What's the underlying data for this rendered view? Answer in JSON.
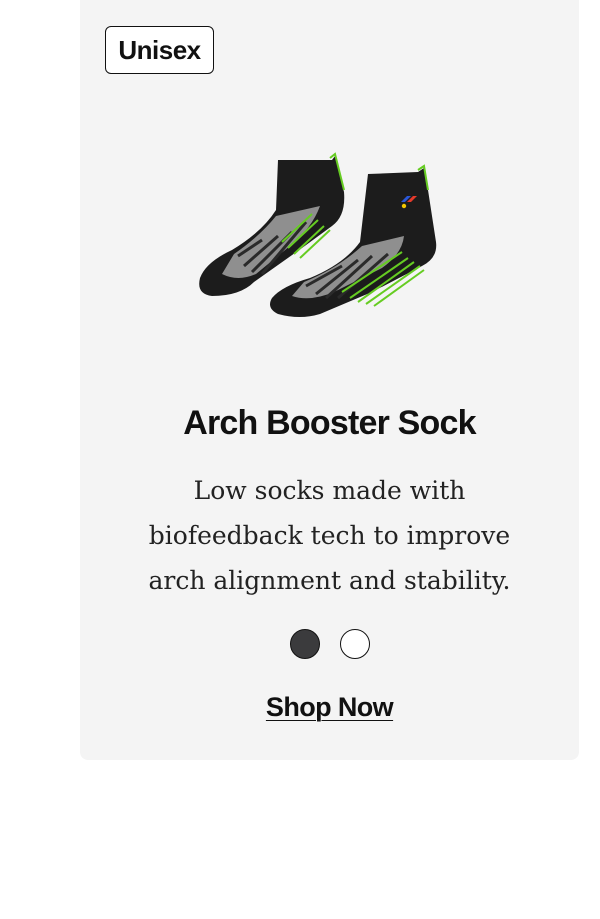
{
  "card": {
    "badge": "Unisex",
    "title": "Arch Booster Sock",
    "description": "Low socks made with biofeedback tech to improve arch alignment and stability.",
    "colors": [
      {
        "hex": "#3b3b3d",
        "selected": true
      },
      {
        "hex": "#ffffff",
        "selected": false
      }
    ],
    "cta_label": "Shop Now"
  }
}
